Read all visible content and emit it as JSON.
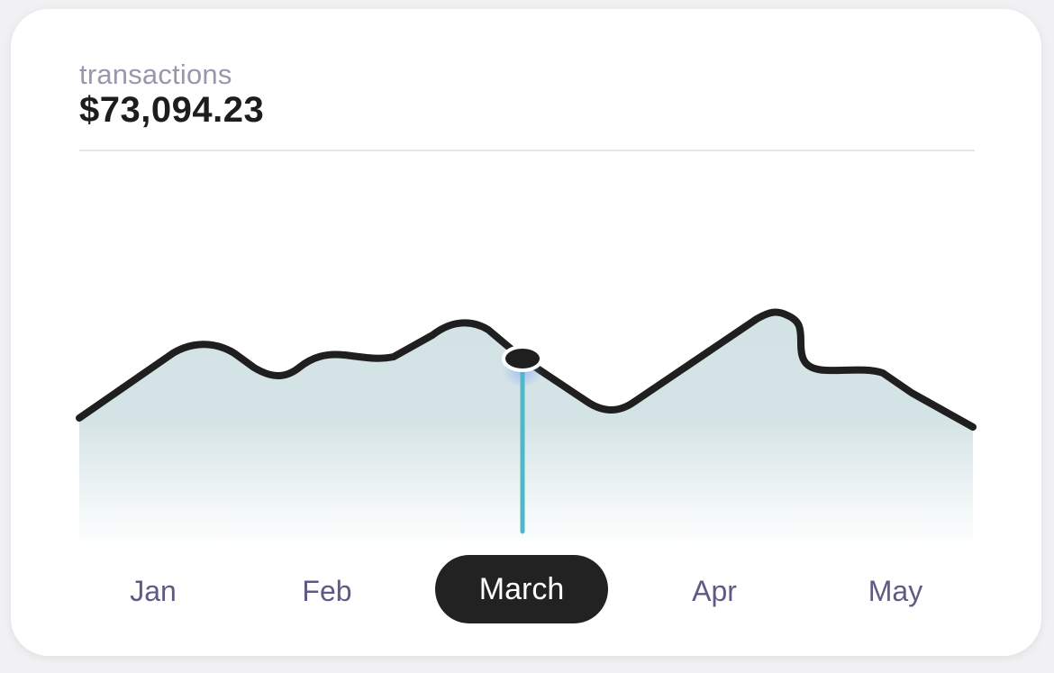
{
  "card": {
    "caption": "transactions",
    "amount": "$73,094.23"
  },
  "months": [
    "Jan",
    "Feb",
    "March",
    "Apr",
    "May"
  ],
  "selected_month": "March",
  "colors": {
    "line": "#1f1f1f",
    "marker": "#4fb8c8",
    "fill": "#d4e4e6",
    "active_pill": "#222222",
    "month_text": "#5f5a85"
  },
  "chart_data": {
    "type": "area",
    "x": [
      "Jan",
      "Feb",
      "March",
      "Apr",
      "May"
    ],
    "grid": false,
    "legend": "none"
  }
}
